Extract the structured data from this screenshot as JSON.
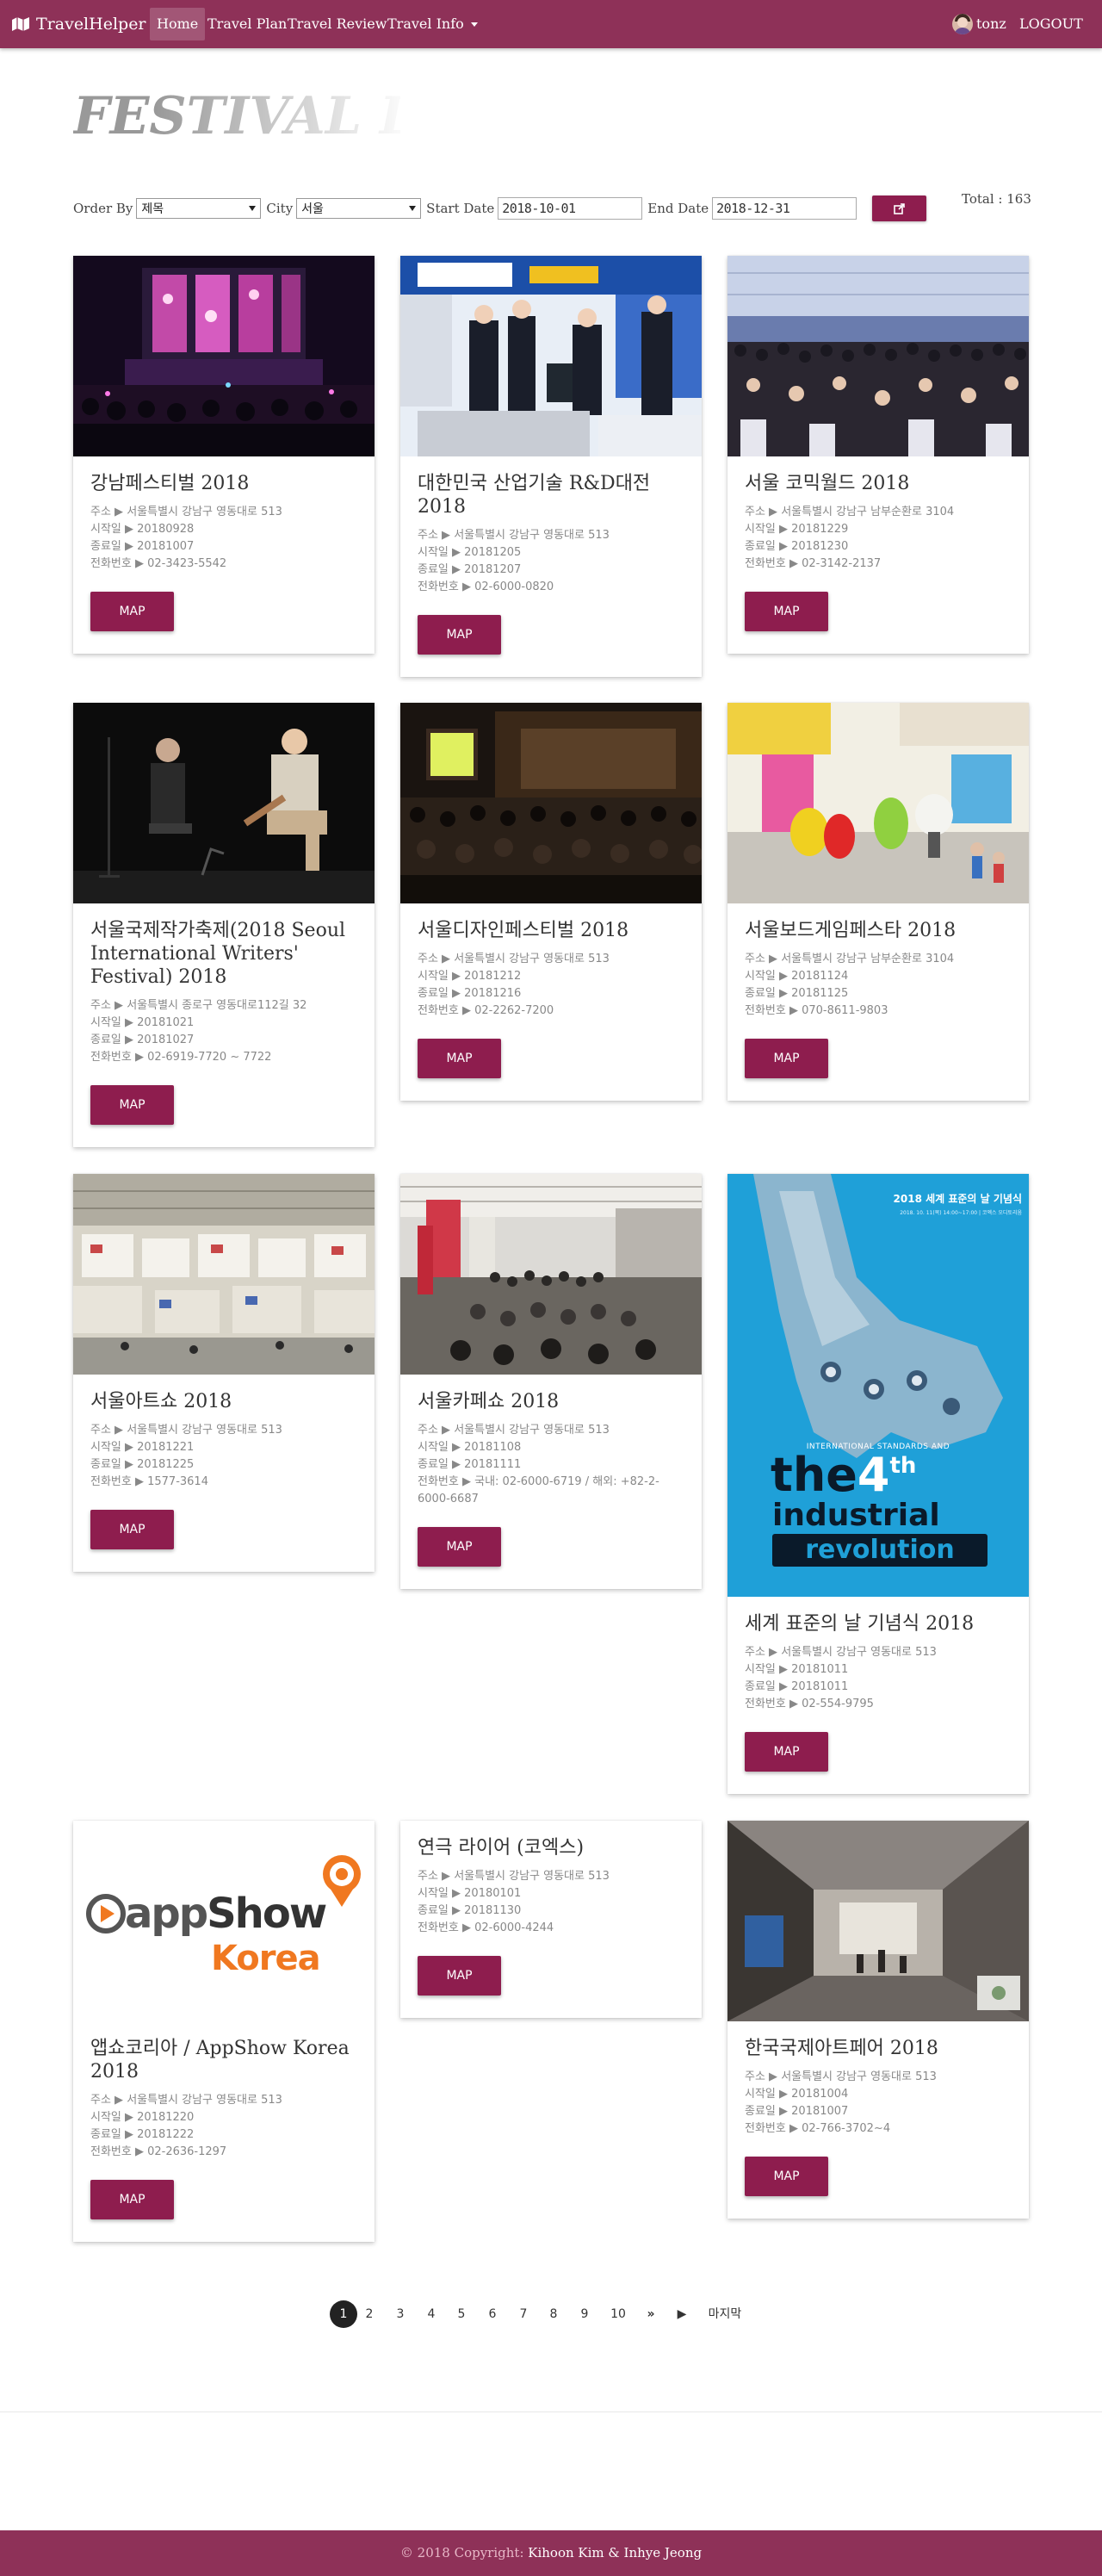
{
  "navbar": {
    "brand": "TravelHelper",
    "items": [
      {
        "label": "Home",
        "active": true
      },
      {
        "label": "Travel Plan",
        "active": false
      },
      {
        "label": "Travel Review",
        "active": false
      },
      {
        "label": "Travel Info",
        "active": false,
        "dropdown": true
      }
    ],
    "username": "tonz",
    "logout": "LOGOUT"
  },
  "header": {
    "title": "FESTIVAL LIST"
  },
  "filters": {
    "order_label": "Order By",
    "order_value": "제목",
    "city_label": "City",
    "city_value": "서울",
    "start_label": "Start Date",
    "start_value": "2018-10-01",
    "end_label": "End Date",
    "end_value": "2018-12-31",
    "search_icon": "external-link-icon"
  },
  "total": "Total : 163",
  "labels": {
    "address": "주소 ▶ ",
    "start": "시작일 ▶ ",
    "end": "종료일 ▶ ",
    "phone": "전화번호 ▶ ",
    "map": "MAP"
  },
  "festivals": [
    {
      "title": "강남페스티벌 2018",
      "address": "서울특별시 강남구 영동대로 513",
      "start": "20180928",
      "end": "20181007",
      "phone": "02-3423-5542",
      "image": "concert-stage-photo"
    },
    {
      "title": "대한민국 산업기술 R&D대전 2018",
      "address": "서울특별시 강남구 영동대로 513",
      "start": "20181205",
      "end": "20181207",
      "phone": "02-6000-0820",
      "image": "exhibition-booth-photo"
    },
    {
      "title": "서울 코믹월드 2018",
      "address": "서울특별시 강남구 남부순환로 3104",
      "start": "20181229",
      "end": "20181230",
      "phone": "02-3142-2137",
      "image": "crowd-hall-photo"
    },
    {
      "title": "서울국제작가축제(2018 Seoul International Writers' Festival) 2018",
      "address": "서울특별시 종로구 영동대로112길 32",
      "start": "20181021",
      "end": "20181027",
      "phone": "02-6919-7720 ~ 7722",
      "image": "writers-stage-photo"
    },
    {
      "title": "서울디자인페스티벌 2018",
      "address": "서울특별시 강남구 영동대로 513",
      "start": "20181212",
      "end": "20181216",
      "phone": "02-2262-7200",
      "image": "auditorium-photo"
    },
    {
      "title": "서울보드게임페스타 2018",
      "address": "서울특별시 강남구 남부순환로 3104",
      "start": "20181124",
      "end": "20181125",
      "phone": "070-8611-9803",
      "image": "mascots-photo"
    },
    {
      "title": "서울아트쇼 2018",
      "address": "서울특별시 강남구 영동대로 513",
      "start": "20181221",
      "end": "20181225",
      "phone": "1577-3614",
      "image": "art-fair-hall-photo"
    },
    {
      "title": "서울카페쇼 2018",
      "address": "서울특별시 강남구 영동대로 513",
      "start": "20181108",
      "end": "20181111",
      "phone": "국내: 02-6000-6719 / 해외: +82-2-6000-6687",
      "image": "cafe-show-photo"
    },
    {
      "title": "세계 표준의 날 기념식 2018",
      "address": "서울특별시 강남구 영동대로 513",
      "start": "20181011",
      "end": "20181011",
      "phone": "02-554-9795",
      "image": "standards-day-poster",
      "poster": {
        "heading": "2018 세계 표준의 날 기념식",
        "subline": "2018. 10. 11(목) 14:00~17:00 | 코엑스 오디토리움",
        "tagline": "INTERNATIONAL STANDARDS AND",
        "line1": "the",
        "line1b": "4",
        "line1c": "th",
        "line2": "industrial",
        "line3": "revolution"
      }
    },
    {
      "title": "앱쇼코리아 / AppShow Korea 2018",
      "address": "서울특별시 강남구 영동대로 513",
      "start": "20181220",
      "end": "20181222",
      "phone": "02-2636-1297",
      "image": "appshow-logo",
      "logo": {
        "word1": "app",
        "word2": "Show",
        "word3": "Korea"
      }
    },
    {
      "title": "연극 라이어 (코엑스)",
      "address": "서울특별시 강남구 영동대로 513",
      "start": "20180101",
      "end": "20181130",
      "phone": "02-6000-4244",
      "image": ""
    },
    {
      "title": "한국국제아트페어 2018",
      "address": "서울특별시 강남구 영동대로 513",
      "start": "20181004",
      "end": "20181007",
      "phone": "02-766-3702~4",
      "image": "mall-corridor-photo"
    }
  ],
  "pagination": {
    "pages": [
      "1",
      "2",
      "3",
      "4",
      "5",
      "6",
      "7",
      "8",
      "9",
      "10"
    ],
    "current": "1",
    "next_group": "»",
    "next": "▶",
    "last": "마지막"
  },
  "footer": {
    "copyright": "© 2018 Copyright: ",
    "names": "Kihoon Kim & Inhye Jeong"
  },
  "colors": {
    "primary": "#8e3158",
    "button": "#8e1d4e",
    "footer_text": "#e8b8c8"
  }
}
